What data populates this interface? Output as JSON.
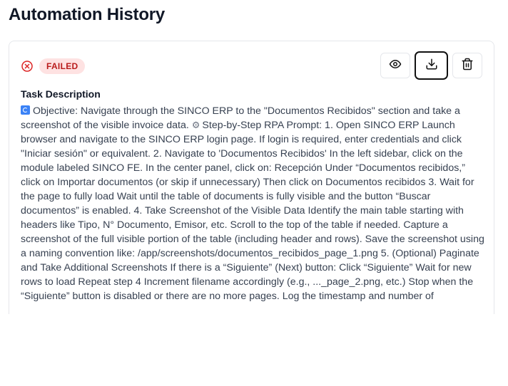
{
  "page": {
    "title": "Automation History"
  },
  "task": {
    "status": "FAILED",
    "status_color": "#b91c1c",
    "status_bg": "#fee2e2",
    "section_label": "Task Description",
    "description_icon_1": "repeat-emoji-icon",
    "description_icon_2": "gear-emoji-icon",
    "description_part_1": "Objective: Navigate through the SINCO ERP to the \"Documentos Recibidos\" section and take a screenshot of the visible invoice data.",
    "description_part_2": "Step-by-Step RPA Prompt: 1. Open SINCO ERP Launch browser and navigate to the SINCO ERP login page. If login is required, enter credentials and click \"Iniciar sesión\" or equivalent. 2. Navigate to 'Documentos Recibidos' In the left sidebar, click on the module labeled SINCO FE. In the center panel, click on: Recepción Under “Documentos recibidos,” click on Importar documentos (or skip if unnecessary) Then click on Documentos recibidos 3. Wait for the page to fully load Wait until the table of documents is fully visible and the button “Buscar documentos” is enabled. 4. Take Screenshot of the Visible Data Identify the main table starting with headers like Tipo, N° Documento, Emisor, etc. Scroll to the top of the table if needed. Capture a screenshot of the full visible portion of the table (including header and rows). Save the screenshot using a naming convention like: /app/screenshots/documentos_recibidos_page_1.png 5. (Optional) Paginate and Take Additional Screenshots If there is a “Siguiente” (Next) button: Click “Siguiente” Wait for new rows to load Repeat step 4 Increment filename accordingly (e.g., ..._page_2.png, etc.) Stop when the “Siguiente” button is disabled or there are no more pages. Log the timestamp and number of"
  },
  "actions": [
    {
      "name": "view-button",
      "icon": "eye-icon"
    },
    {
      "name": "download-button",
      "icon": "download-icon"
    },
    {
      "name": "delete-button",
      "icon": "trash-icon"
    }
  ]
}
